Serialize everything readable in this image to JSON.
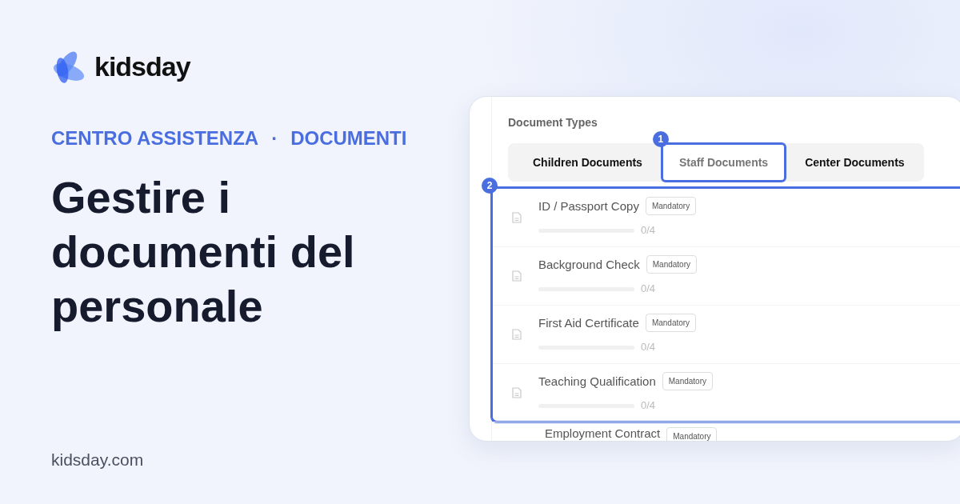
{
  "brand": {
    "name": "kidsday"
  },
  "breadcrumb": {
    "items": [
      "CENTRO ASSISTENZA",
      "DOCUMENTI"
    ],
    "separator": "·"
  },
  "headline": "Gestire i documenti del personale",
  "site_url": "kidsday.com",
  "app": {
    "section_title": "Document Types",
    "tabs": [
      {
        "label": "Children Documents",
        "selected": false
      },
      {
        "label": "Staff Documents",
        "selected": true
      },
      {
        "label": "Center Documents",
        "selected": false
      }
    ],
    "tab_marker": "1",
    "list_marker": "2",
    "documents": [
      {
        "name": "ID / Passport Copy",
        "badge": "Mandatory",
        "count": "0/4",
        "level": 0
      },
      {
        "name": "Background Check",
        "badge": "Mandatory",
        "count": "0/4",
        "level": 0
      },
      {
        "name": "First Aid Certificate",
        "badge": "Mandatory",
        "count": "0/4",
        "level": 0
      },
      {
        "name": "Teaching Qualification",
        "badge": "Mandatory",
        "count": "0/4",
        "level": 0
      },
      {
        "name": "Employment Contract",
        "badge": "Mandatory",
        "kind": "partial"
      }
    ]
  }
}
